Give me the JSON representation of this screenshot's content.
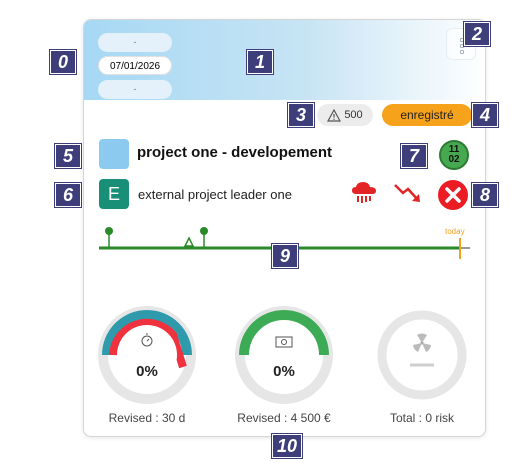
{
  "header": {
    "pill_top": "-",
    "date": "07/01/2026",
    "pill_bottom": "-"
  },
  "alerts": {
    "warning_count": "500",
    "status_label": "enregistré",
    "status_color": "#f7a21b"
  },
  "project": {
    "title": "project one - developement",
    "color": "#8dcaf0",
    "date_badge_top": "11",
    "date_badge_bottom": "02",
    "leader_initial": "E",
    "leader_name": "external project leader one"
  },
  "timeline": {
    "today_label": "today",
    "line_color": "#2a8a2a"
  },
  "gauges": [
    {
      "icon": "stopwatch-icon",
      "percent": "0%",
      "label": "Revised : 30 d"
    },
    {
      "icon": "banknote-icon",
      "percent": "0%",
      "label": "Revised : 4 500 €"
    },
    {
      "icon": "radiation-icon",
      "percent": "",
      "label": "Total : 0 risk"
    }
  ],
  "markers": [
    "0",
    "1",
    "2",
    "3",
    "4",
    "5",
    "6",
    "7",
    "8",
    "9",
    "10"
  ]
}
